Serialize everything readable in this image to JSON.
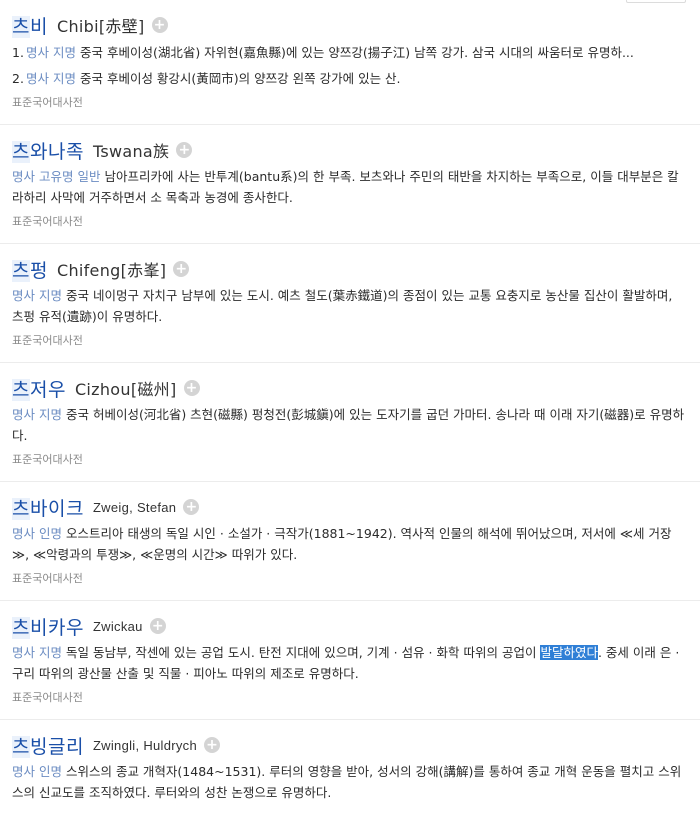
{
  "entries": [
    {
      "headword": "츠비",
      "origin": "Chibi[赤壁]",
      "definitions": [
        {
          "num": "1.",
          "pos": "명사 지명",
          "text": "중국 후베이성(湖北省) 자위현(嘉魚縣)에 있는 양쯔강(揚子江) 남쪽 강가. 삼국 시대의 싸움터로 유명하..."
        },
        {
          "num": "2.",
          "pos": "명사 지명",
          "text": "중국 후베이성 황강시(黃岡市)의 양쯔강 왼쪽 강가에 있는 산."
        }
      ],
      "source": "표준국어대사전"
    },
    {
      "headword": "츠와나족",
      "origin": "Tswana族",
      "pos": "명사 고유명 일반",
      "text": "남아프리카에 사는 반투계(bantu系)의 한 부족. 보츠와나 주민의 태반을 차지하는 부족으로, 이들 대부분은 칼라하리 사막에 거주하면서 소 목축과 농경에 종사한다.",
      "source": "표준국어대사전"
    },
    {
      "headword": "츠펑",
      "origin": "Chifeng[赤峯]",
      "pos": "명사 지명",
      "text": "중국 네이멍구 자치구 남부에 있는 도시. 예츠 철도(葉赤鐵道)의 종점이 있는 교통 요충지로 농산물 집산이 활발하며, 츠펑 유적(遺跡)이 유명하다.",
      "source": "표준국어대사전"
    },
    {
      "headword": "츠저우",
      "origin": "Cizhou[磁州]",
      "pos": "명사 지명",
      "text": "중국 허베이성(河北省) 츠현(磁縣) 펑청전(彭城鎭)에 있는 도자기를 굽던 가마터. 송나라 때 이래 자기(磁器)로 유명하다.",
      "source": "표준국어대사전"
    },
    {
      "headword": "츠바이크",
      "origin": "Zweig, Stefan",
      "pos": "명사 인명",
      "text": "오스트리아 태생의 독일 시인 · 소설가 · 극작가(1881~1942). 역사적 인물의 해석에 뛰어났으며, 저서에 ≪세 거장≫, ≪악령과의 투쟁≫, ≪운명의 시간≫ 따위가 있다.",
      "source": "표준국어대사전"
    },
    {
      "headword": "츠비카우",
      "origin": "Zwickau",
      "pos": "명사 지명",
      "text_before": "독일 동남부, 작센에 있는 공업 도시. 탄전 지대에 있으며, 기계 · 섬유 · 화학 따위의 공업이 ",
      "text_selected": "발달하였다",
      "text_after": ". 중세 이래 은 · 구리 따위의 광산물 산출 및 직물 · 피아노 따위의 제조로 유명하다.",
      "source": "표준국어대사전"
    },
    {
      "headword": "츠빙글리",
      "origin": "Zwingli, Huldrych",
      "pos": "명사 인명",
      "text": "스위스의 종교 개혁자(1484~1531). 루터의 영향을 받아, 성서의 강해(講解)를 통하여 종교 개혁 운동을 펼치고 스위스의 신교도를 조직하였다. 루터와의 성찬 논쟁으로 유명하다."
    }
  ],
  "icons": {
    "add": "plus-circle-icon"
  },
  "colors": {
    "headword": "#1a4fa8",
    "pos": "#6b8cc2",
    "selection": "#2f7fd6"
  }
}
